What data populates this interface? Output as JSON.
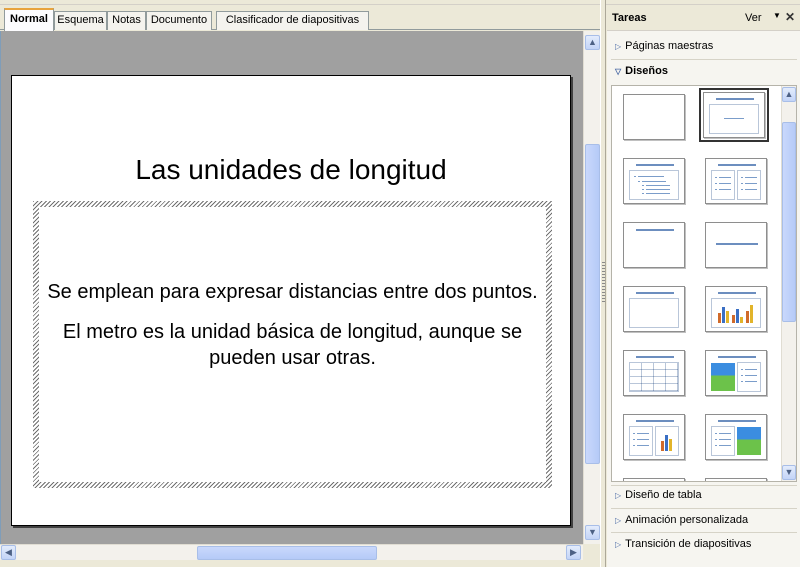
{
  "tabs": [
    {
      "label": "Normal",
      "active": true
    },
    {
      "label": "Esquema",
      "active": false
    },
    {
      "label": "Notas",
      "active": false
    },
    {
      "label": "Documento",
      "active": false
    },
    {
      "label": "Clasificador de diapositivas",
      "active": false
    }
  ],
  "slide": {
    "title": "Las unidades de longitud",
    "paragraphs": [
      "Se emplean para expresar distancias entre dos puntos.",
      "El metro es la unidad básica de longitud, aunque se pueden usar otras."
    ]
  },
  "task_pane": {
    "title": "Tareas",
    "view_label": "Ver",
    "sections": {
      "master_pages": "Páginas maestras",
      "layouts": "Diseños",
      "table_design": "Diseño de tabla",
      "custom_animation": "Animación personalizada",
      "slide_transition": "Transición de diapositivas"
    },
    "layouts": [
      "blank",
      "title-content",
      "title-2-content",
      "title-2-content-alt",
      "title-only",
      "centered-text",
      "title-2-content-vertical",
      "title-content-chart",
      "title-table",
      "title-image-content",
      "title-content-chart-2",
      "title-content-image",
      "partial-1",
      "partial-2"
    ],
    "selected_layout": "title-content"
  },
  "icons": {
    "scroll_up": "scroll-up-arrow-icon",
    "scroll_down": "scroll-down-arrow-icon",
    "scroll_left": "scroll-left-arrow-icon",
    "scroll_right": "scroll-right-arrow-icon",
    "section_collapsed": "triangle-right-icon",
    "section_expanded": "triangle-down-icon",
    "close": "close-icon"
  },
  "colors": {
    "active_tab_accent": "#e8a33d",
    "workspace": "#a0a0a0",
    "layout_accent": "#6c8ebf"
  }
}
